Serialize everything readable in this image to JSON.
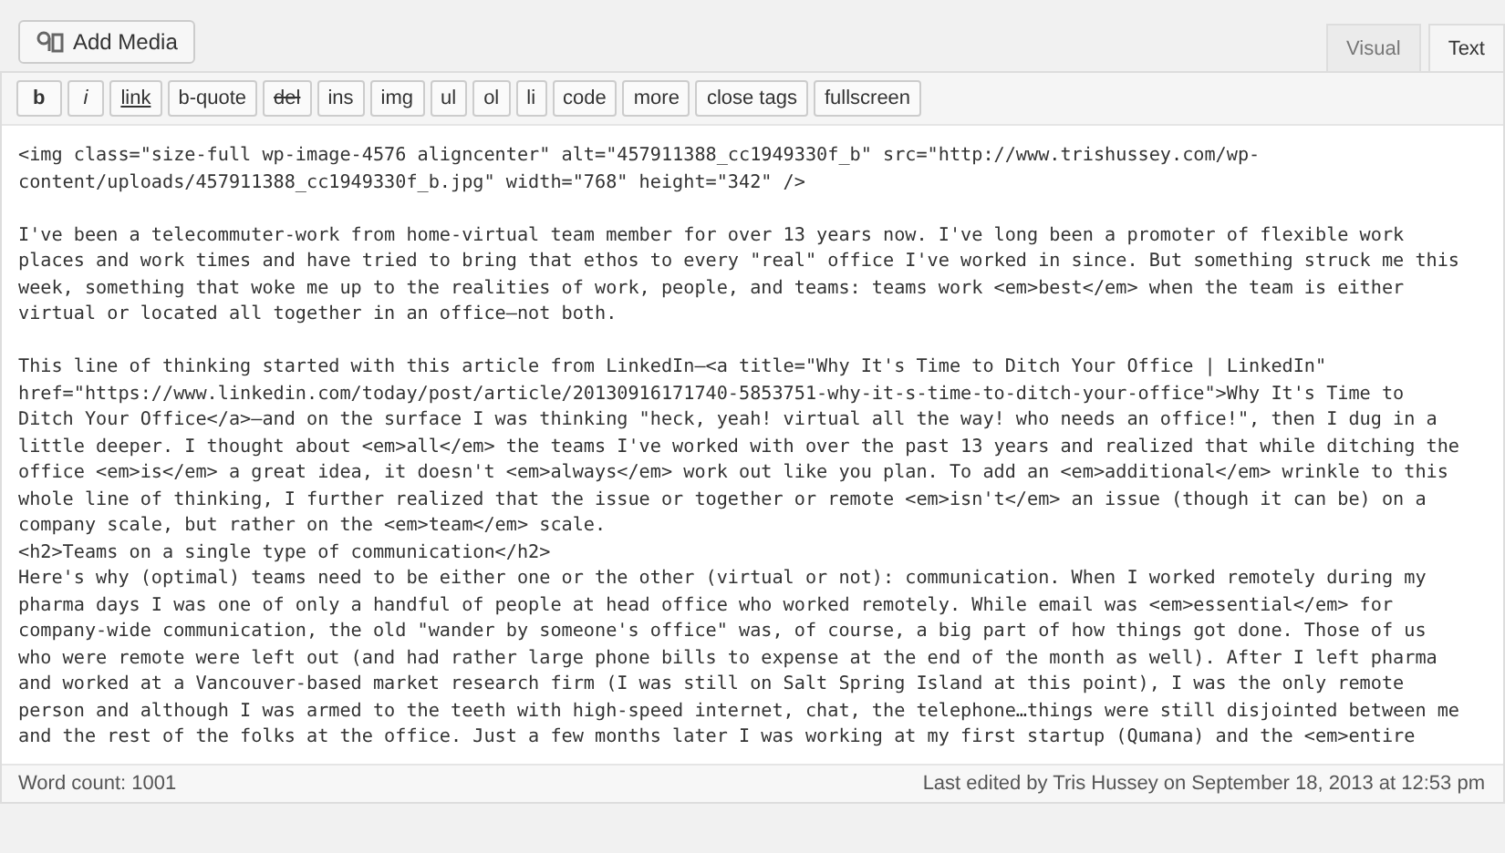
{
  "add_media": {
    "label": "Add Media"
  },
  "tabs": [
    {
      "label": "Visual",
      "selected": false
    },
    {
      "label": "Text",
      "selected": true
    }
  ],
  "toolbar": [
    "b",
    "i",
    "link",
    "b-quote",
    "del",
    "ins",
    "img",
    "ul",
    "ol",
    "li",
    "code",
    "more",
    "close tags",
    "fullscreen"
  ],
  "editor": {
    "blocks": [
      [
        "<img class=\"size-full wp-image-4576 aligncenter\" alt=\"457911388_cc1949330f_b\" src=\"http://www.trishussey.com/wp-",
        "content/uploads/457911388_cc1949330f_b.jpg\" width=\"768\" height=\"342\" />"
      ],
      [
        "I've been a telecommuter-work from home-virtual team member for over 13 years now. I've long been a promoter of flexible work",
        "places and work times and have tried to bring that ethos to every \"real\" office I've worked in since. But something struck me this",
        "week, something that woke me up to the realities of work, people, and teams: teams work <em>best</em> when the team is either",
        "virtual or located all together in an office—not both."
      ],
      [
        "This line of thinking started with this article from LinkedIn—<a title=\"Why It's Time to Ditch Your Office | LinkedIn\"",
        "href=\"https://www.linkedin.com/today/post/article/20130916171740-5853751-why-it-s-time-to-ditch-your-office\">Why It's Time to",
        "Ditch Your Office</a>—and on the surface I was thinking \"heck, yeah! virtual all the way! who needs an office!\", then I dug in a",
        "little deeper. I thought about <em>all</em> the teams I've worked with over the past 13 years and realized that while ditching the",
        "office <em>is</em> a great idea, it doesn't <em>always</em> work out like you plan. To add an <em>additional</em> wrinkle to this",
        "whole line of thinking, I further realized that the issue or together or remote <em>isn't</em> an issue (though it can be) on a",
        "company scale, but rather on the <em>team</em> scale.",
        "<h2>Teams on a single type of communication</h2>",
        "Here's why (optimal) teams need to be either one or the other (virtual or not): communication. When I worked remotely during my",
        "pharma days I was one of only a handful of people at head office who worked remotely. While email was <em>essential</em> for",
        "company-wide communication, the old \"wander by someone's office\" was, of course, a big part of how things got done. Those of us",
        "who were remote were left out (and had rather large phone bills to expense at the end of the month as well). After I left pharma",
        "and worked at a Vancouver-based market research firm (I was still on Salt Spring Island at this point), I was the only remote",
        "person and although I was armed to the teeth with high-speed internet, chat, the telephone…things were still disjointed between me",
        "and the rest of the folks at the office. Just a few months later I was working at my first startup (Qumana) and the <em>entire"
      ]
    ]
  },
  "status_bar": {
    "word_count": "Word count: 1001",
    "last_edited": "Last edited by Tris Hussey on September 18, 2013 at 12:53 pm"
  }
}
